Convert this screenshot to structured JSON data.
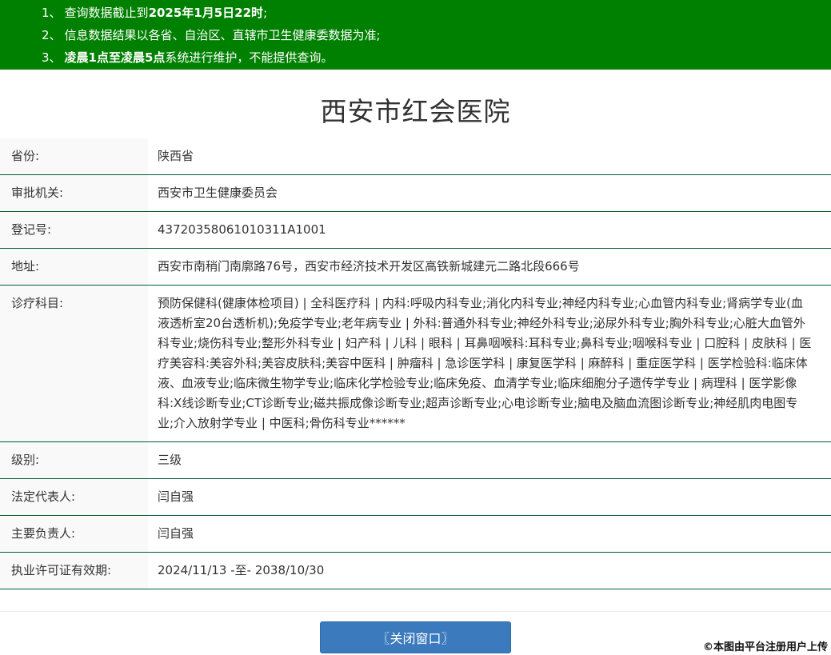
{
  "notices": {
    "items": [
      {
        "num": "1、",
        "segments": [
          {
            "text": "查询数据截止到",
            "bold": false
          },
          {
            "text": "2025年1月5日22时",
            "bold": true
          },
          {
            "text": ";",
            "bold": false
          }
        ]
      },
      {
        "num": "2、",
        "segments": [
          {
            "text": "信息数据结果以各省、自治区、直辖市卫生健康委数据为准;",
            "bold": false
          }
        ]
      },
      {
        "num": "3、",
        "segments": [
          {
            "text": "凌晨1点至凌晨5点",
            "bold": true
          },
          {
            "text": "系统进行维护，不能提供查询。",
            "bold": false
          }
        ]
      }
    ]
  },
  "header": {
    "title": "西安市红会医院"
  },
  "info_table": {
    "rows": [
      {
        "label": "省份:",
        "value": "陕西省"
      },
      {
        "label": "审批机关:",
        "value": "西安市卫生健康委员会"
      },
      {
        "label": "登记号:",
        "value": "43720358061010311A1001"
      },
      {
        "label": "地址:",
        "value": "西安市南稍门南廓路76号，西安市经济技术开发区高铁新城建元二路北段666号"
      },
      {
        "label": "诊疗科目:",
        "value": "预防保健科(健康体检项目) | 全科医疗科 | 内科:呼吸内科专业;消化内科专业;神经内科专业;心血管内科专业;肾病学专业(血液透析室20台透析机);免疫学专业;老年病专业 | 外科:普通外科专业;神经外科专业;泌尿外科专业;胸外科专业;心脏大血管外科专业;烧伤科专业;整形外科专业 | 妇产科 | 儿科 | 眼科 | 耳鼻咽喉科:耳科专业;鼻科专业;咽喉科专业 | 口腔科 | 皮肤科 | 医疗美容科:美容外科;美容皮肤科;美容中医科 | 肿瘤科 | 急诊医学科 | 康复医学科 | 麻醉科 | 重症医学科 | 医学检验科:临床体液、血液专业;临床微生物学专业;临床化学检验专业;临床免疫、血清学专业;临床细胞分子遗传学专业 | 病理科 | 医学影像科:X线诊断专业;CT诊断专业;磁共振成像诊断专业;超声诊断专业;心电诊断专业;脑电及脑血流图诊断专业;神经肌肉电图专业;介入放射学专业 | 中医科;骨伤科专业******"
      },
      {
        "label": "级别:",
        "value": "三级"
      },
      {
        "label": "法定代表人:",
        "value": "闫自强"
      },
      {
        "label": "主要负责人:",
        "value": "闫自强"
      },
      {
        "label": "执业许可证有效期:",
        "value": "2024/11/13 -至- 2038/10/30"
      }
    ]
  },
  "footer": {
    "close_button_label": "〖关闭窗口〗",
    "watermark": "©本图由平台注册用户上传"
  },
  "colors": {
    "notice_bg": "#008000",
    "row_border": "#00602f",
    "label_bg": "#f9f9f9",
    "button_bg": "#3a7abd"
  }
}
